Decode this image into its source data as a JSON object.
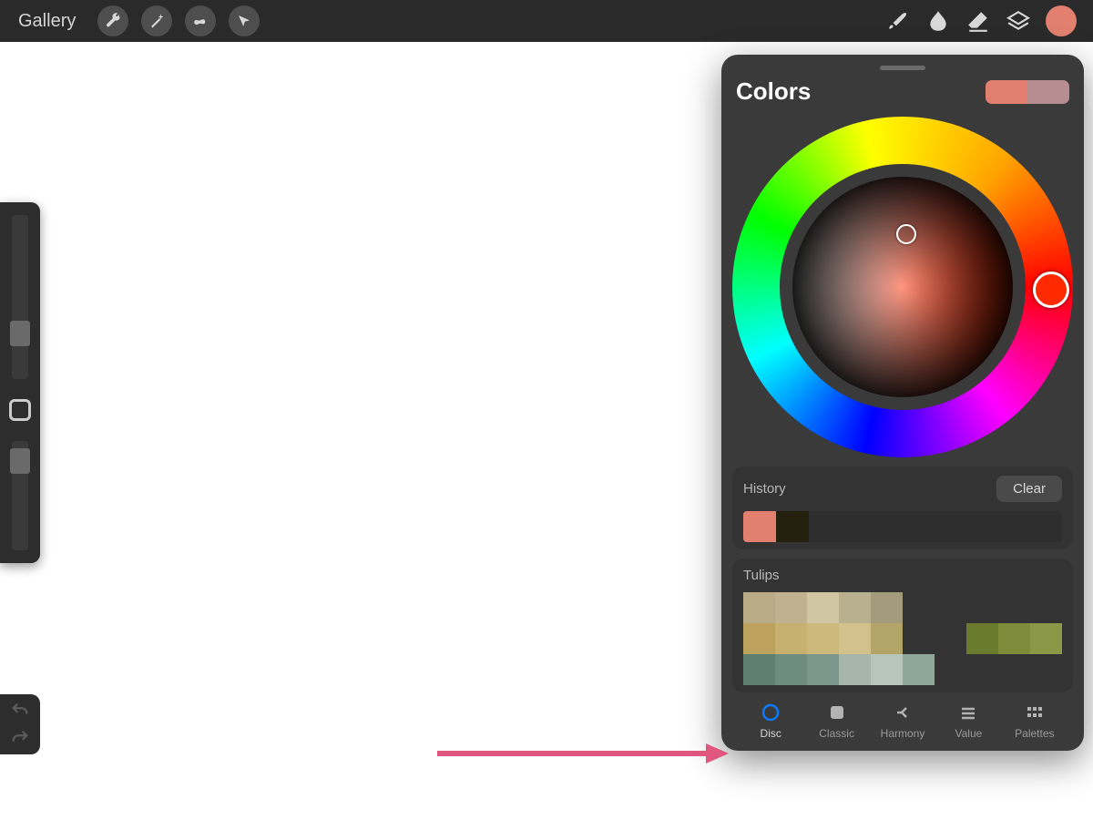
{
  "toolbar": {
    "gallery_label": "Gallery"
  },
  "current_color": "#e27f6f",
  "secondary_color": "#b88d92",
  "panel": {
    "title": "Colors",
    "history_label": "History",
    "clear_label": "Clear",
    "history_colors": [
      "#e27f6f",
      "#24210f"
    ],
    "palette_name": "Tulips",
    "palette_colors": [
      "#b9ab86",
      "#c0b28f",
      "#d0c6a3",
      "#b9b08f",
      "#a39b7b",
      "",
      "",
      "",
      "",
      "",
      "#bda25e",
      "#c7b070",
      "#cdb97c",
      "#d3c18b",
      "#b3a468",
      "",
      "",
      "#6a7a2e",
      "#7d8b3a",
      "#8b9847",
      "#5f7f73",
      "#6d8b7f",
      "#7b978b",
      "#a7b6ab",
      "#b8c5bb",
      "#8ea797",
      "",
      "",
      "",
      ""
    ],
    "tabs": [
      {
        "label": "Disc",
        "key": "disc"
      },
      {
        "label": "Classic",
        "key": "classic"
      },
      {
        "label": "Harmony",
        "key": "harmony"
      },
      {
        "label": "Value",
        "key": "value"
      },
      {
        "label": "Palettes",
        "key": "palettes"
      }
    ],
    "active_tab": "disc"
  }
}
